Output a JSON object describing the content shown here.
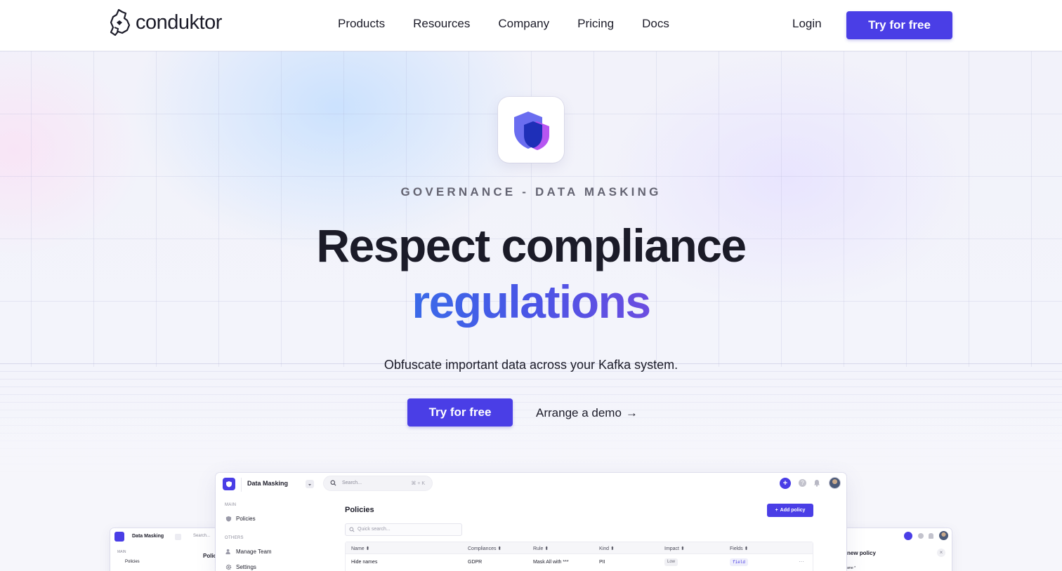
{
  "header": {
    "logo_text": "conduktor",
    "nav": [
      "Products",
      "Resources",
      "Company",
      "Pricing",
      "Docs"
    ],
    "login_label": "Login",
    "cta_label": "Try for free"
  },
  "hero": {
    "eyebrow": "GOVERNANCE - DATA MASKING",
    "headline": "Respect compliance",
    "headline_accent": "regulations",
    "subhead": "Obfuscate important data across your Kafka system.",
    "cta_label": "Try for free",
    "demo_label": "Arrange a demo",
    "demo_arrow": "→"
  },
  "mockup": {
    "app_name": "Data Masking",
    "search_placeholder": "Search...",
    "search_shortcut": "⌘ + K",
    "sidebar": {
      "main_label": "MAIN",
      "policies": "Policies",
      "others_label": "OTHERS",
      "manage_team": "Manage Team",
      "settings": "Settings"
    },
    "title": "Policies",
    "add_button": "Add policy",
    "quick_search_placeholder": "Quick search...",
    "columns": [
      "Name",
      "Compliances",
      "Rule",
      "Kind",
      "Impact",
      "Fields"
    ],
    "rows": [
      {
        "name": "Hide names",
        "compliance": "GDPR",
        "rule": "Mask All with ***",
        "kind": "PII",
        "impact": "Low",
        "field": "field"
      }
    ]
  },
  "mockup_left": {
    "app_name": "Data Masking",
    "search_placeholder": "Search...",
    "main_label": "MAIN",
    "policies": "Policies",
    "title": "Polic"
  },
  "mockup_right": {
    "title": "new policy",
    "close": "×",
    "field_label": "ame *"
  },
  "colors": {
    "brand": "#4a3ee6",
    "accent_gradient_start": "#3a6ae8",
    "accent_gradient_end": "#6b4de0"
  },
  "icons": [
    "conduktor-logo-icon",
    "shield-icon",
    "search-icon",
    "plus-icon",
    "help-icon",
    "bell-icon",
    "avatar",
    "shield-small-icon",
    "team-icon",
    "gear-icon",
    "sort-icon",
    "arrow-right-icon"
  ]
}
